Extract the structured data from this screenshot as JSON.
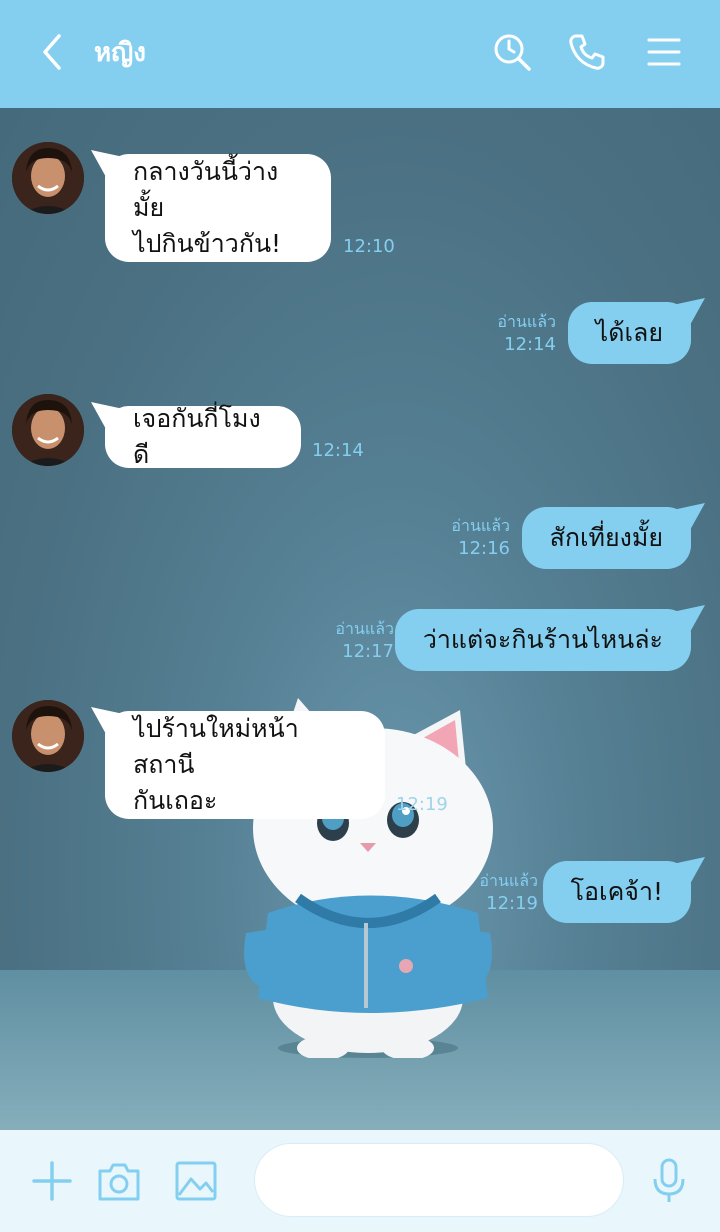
{
  "header": {
    "back_icon": "chevron-left-icon",
    "title": "หญิง",
    "actions": [
      "search-clock-icon",
      "phone-icon",
      "menu-icon"
    ]
  },
  "colors": {
    "accent": "#84CFF0",
    "header_bg": "#84CFF0",
    "footer_bg": "#E9F7FD",
    "incoming_bubble": "#FFFFFF",
    "outgoing_bubble": "#84CFF0"
  },
  "messages": [
    {
      "side": "in",
      "lines": [
        "กลางวันนี้ว่างมั้ย",
        "ไปกินข้าวกัน!"
      ],
      "time": "12:10"
    },
    {
      "side": "out",
      "text": "ได้เลย",
      "read": "อ่านแล้ว",
      "time": "12:14"
    },
    {
      "side": "in",
      "lines": [
        "เจอกันกี่โมงดี"
      ],
      "time": "12:14"
    },
    {
      "side": "out",
      "text": "สักเที่ยงมั้ย",
      "read": "อ่านแล้ว",
      "time": "12:16"
    },
    {
      "side": "out",
      "text": "ว่าแต่จะกินร้านไหนล่ะ",
      "read": "อ่านแล้ว",
      "time": "12:17"
    },
    {
      "side": "in",
      "lines": [
        "ไปร้านใหม่หน้าสถานี",
        "กันเถอะ"
      ],
      "time": "12:19"
    },
    {
      "side": "out",
      "text": "โอเคจ้า!",
      "read": "อ่านแล้ว",
      "time": "12:19"
    }
  ],
  "footer": {
    "icons": [
      "plus-icon",
      "camera-icon",
      "image-icon",
      "smiley-icon",
      "microphone-icon"
    ],
    "input_value": ""
  }
}
